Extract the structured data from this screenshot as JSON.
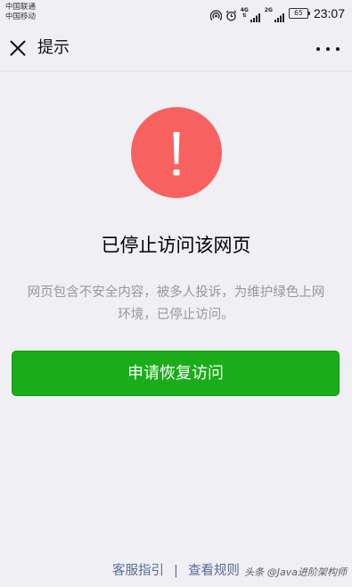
{
  "status_bar": {
    "carrier_1": "中国联通",
    "carrier_2": "中国移动",
    "net_1_gen": "4G",
    "net_2_gen": "2G",
    "battery": "65",
    "time": "23:07"
  },
  "title_bar": {
    "title": "提示",
    "close_icon": "close-icon",
    "more_icon": "more-dots-icon"
  },
  "main": {
    "icon": "exclamation-icon",
    "icon_color": "#f76260",
    "headline": "已停止访问该网页",
    "description": "网页包含不安全内容，被多人投诉，为维护绿色上网环境，已停止访问。",
    "restore_button": "申请恢复访问",
    "button_color": "#1aad19"
  },
  "footer": {
    "link_1": "客服指引",
    "separator": "|",
    "link_2": "查看规则",
    "link_color": "#586c94"
  },
  "watermark": {
    "text": "头条 @Java进阶架构师"
  }
}
